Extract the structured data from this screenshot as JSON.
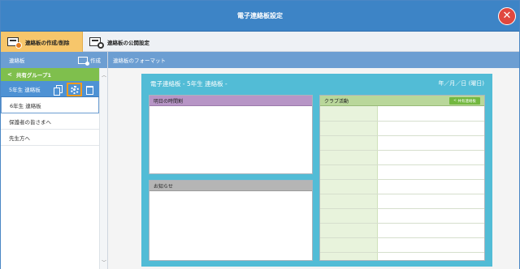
{
  "window": {
    "title": "電子連絡板設定"
  },
  "tabs": [
    {
      "label": "連絡板の作成/削除",
      "active": true,
      "icon": "board-add-icon"
    },
    {
      "label": "連絡板の公開設定",
      "active": false,
      "icon": "board-settings-icon"
    }
  ],
  "sidebar": {
    "header_label": "連絡板",
    "create_label": "作成",
    "group": {
      "label": "共有グループ1",
      "icon": "share-icon"
    },
    "items": [
      {
        "label": "5年生 連絡板",
        "selected": true
      },
      {
        "label": "6年生 連絡板",
        "selected": false
      },
      {
        "label": "保護者の皆さまへ",
        "selected": false
      },
      {
        "label": "先生方へ",
        "selected": false
      }
    ]
  },
  "main": {
    "header_label": "連絡板のフォーマット",
    "board": {
      "title": "電子連絡板 - 5年生 連絡板 -",
      "date": "年／月／日 (曜日)",
      "panels": {
        "schedule": "明日の時間割",
        "notice": "お知らせ",
        "club": "クラブ活動",
        "club_button": "共有連絡板"
      }
    }
  },
  "colors": {
    "titlebar": "#3d84c6",
    "active_tab": "#f7c66b",
    "group_header": "#7fbf4d",
    "selected_item": "#4e92d4",
    "highlight": "#f39b1a",
    "board": "#52bcd6"
  }
}
